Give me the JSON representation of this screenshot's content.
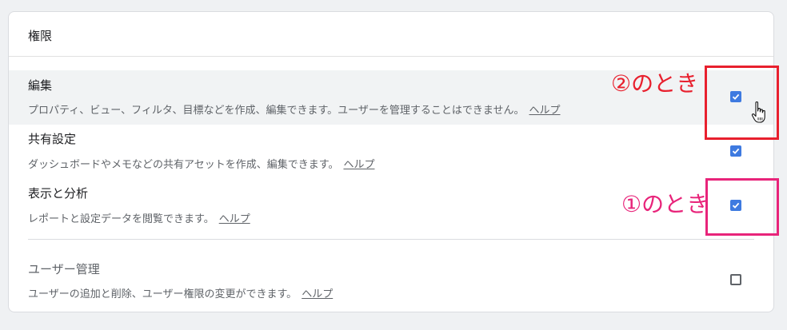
{
  "panel": {
    "title": "権限"
  },
  "permissions": [
    {
      "title": "編集",
      "description": "プロパティ、ビュー、フィルタ、目標などを作成、編集できます。ユーザーを管理することはできません。",
      "help": "ヘルプ",
      "checked": true
    },
    {
      "title": "共有設定",
      "description": "ダッシュボードやメモなどの共有アセットを作成、編集できます。",
      "help": "ヘルプ",
      "checked": true
    },
    {
      "title": "表示と分析",
      "description": "レポートと設定データを閲覧できます。",
      "help": "ヘルプ",
      "checked": true
    },
    {
      "title": "ユーザー管理",
      "description": "ユーザーの追加と削除、ユーザー権限の変更ができます。",
      "help": "ヘルプ",
      "checked": false
    }
  ],
  "annotations": {
    "edit_label": "②のとき",
    "view_label": "①のとき",
    "colors": {
      "red": "#e8202e",
      "pink": "#e8247a",
      "checkbox": "#3e7ae0"
    }
  },
  "cursor_icon": "hand-pointer-icon"
}
